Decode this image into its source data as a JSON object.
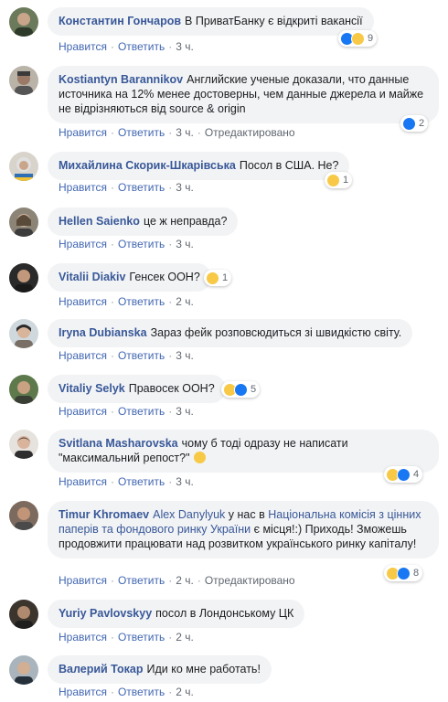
{
  "actions": {
    "like": "Нравится",
    "reply": "Ответить",
    "edited": "Отредактировано"
  },
  "comments": [
    {
      "author": "Константин Гончаров",
      "text": "В ПриватБанку є відкриті вакансії",
      "time": "3 ч.",
      "reactions": "9"
    },
    {
      "author": "Kostiantyn Barannikov",
      "text": "Английские ученые доказали, что данные источника на 12% менее достоверны, чем данные джерела и майже не відрізняються від source & origin",
      "time": "3 ч.",
      "reactions": "2"
    },
    {
      "author": "Михайлина Скорик-Шкарівська",
      "text": "Посол в США. Не?",
      "time": "3 ч.",
      "reactions": "1"
    },
    {
      "author": "Hellen Saienko",
      "text": "це ж неправда?",
      "time": "3 ч."
    },
    {
      "author": "Vitalii Diakiv",
      "text": "Генсек ООН?",
      "time": "2 ч.",
      "reactions": "1"
    },
    {
      "author": "Iryna Dubianska",
      "text": "Зараз фейк розповсюдиться зі швидкістю світу.",
      "time": "3 ч."
    },
    {
      "author": "Vitaliy Selyk",
      "text": "Правосек ООН?",
      "time": "3 ч.",
      "reactions": "5"
    },
    {
      "author": "Svitlana Masharovska",
      "text": "чому б тоді одразу не написати \"максимальний репост?\"",
      "time": "3 ч.",
      "reactions": "4"
    },
    {
      "author": "Timur Khromaev",
      "mention": "Alex Danylyuk",
      "text_a": "у нас в",
      "link": "Національна комісія з цінних паперів та фондового ринку України",
      "text_b": "є місця!:) Приходь! Зможешь продовжити працювати над розвитком українського ринку капіталу!",
      "time": "2 ч.",
      "reactions": "8"
    },
    {
      "author": "Yuriy Pavlovskyy",
      "text": "посол в Лондонському ЦК",
      "time": "2 ч."
    },
    {
      "author": "Валерий Токар",
      "text": "Иди ко мне работать!",
      "time": "2 ч."
    }
  ],
  "colors": {
    "link": "#385898",
    "bubble": "#f2f3f5",
    "action": "#4267b2"
  }
}
